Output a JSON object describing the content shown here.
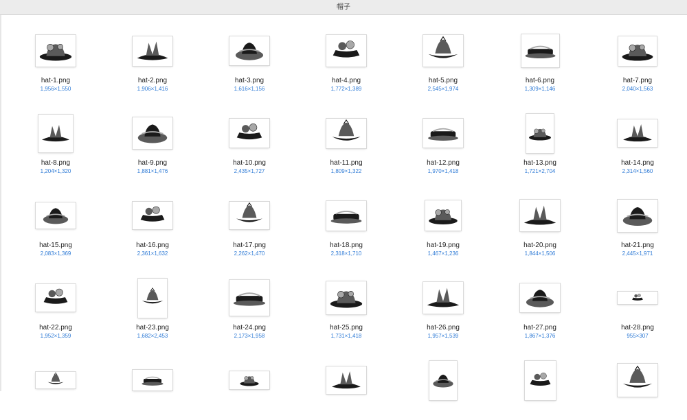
{
  "window": {
    "title": "帽子"
  },
  "items": [
    {
      "name": "hat-1.png",
      "dims": "1,956×1,550",
      "icon": "hat-image-icon"
    },
    {
      "name": "hat-2.png",
      "dims": "1,906×1,416",
      "icon": "hat-image-icon"
    },
    {
      "name": "hat-3.png",
      "dims": "1,616×1,156",
      "icon": "hat-image-icon"
    },
    {
      "name": "hat-4.png",
      "dims": "1,772×1,389",
      "icon": "hat-image-icon"
    },
    {
      "name": "hat-5.png",
      "dims": "2,545×1,974",
      "icon": "hat-image-icon"
    },
    {
      "name": "hat-6.png",
      "dims": "1,309×1,146",
      "icon": "hat-image-icon"
    },
    {
      "name": "hat-7.png",
      "dims": "2,040×1,563",
      "icon": "hat-image-icon"
    },
    {
      "name": "hat-8.png",
      "dims": "1,204×1,320",
      "icon": "hat-image-icon"
    },
    {
      "name": "hat-9.png",
      "dims": "1,881×1,476",
      "icon": "hat-image-icon"
    },
    {
      "name": "hat-10.png",
      "dims": "2,435×1,727",
      "icon": "hat-image-icon"
    },
    {
      "name": "hat-11.png",
      "dims": "1,809×1,322",
      "icon": "hat-image-icon"
    },
    {
      "name": "hat-12.png",
      "dims": "1,970×1,418",
      "icon": "hat-image-icon"
    },
    {
      "name": "hat-13.png",
      "dims": "1,721×2,704",
      "icon": "hat-image-icon"
    },
    {
      "name": "hat-14.png",
      "dims": "2,314×1,560",
      "icon": "hat-image-icon"
    },
    {
      "name": "hat-15.png",
      "dims": "2,083×1,369",
      "icon": "hat-image-icon"
    },
    {
      "name": "hat-16.png",
      "dims": "2,361×1,632",
      "icon": "hat-image-icon"
    },
    {
      "name": "hat-17.png",
      "dims": "2,262×1,470",
      "icon": "hat-image-icon"
    },
    {
      "name": "hat-18.png",
      "dims": "2,318×1,710",
      "icon": "hat-image-icon"
    },
    {
      "name": "hat-19.png",
      "dims": "1,467×1,236",
      "icon": "hat-image-icon"
    },
    {
      "name": "hat-20.png",
      "dims": "1,844×1,506",
      "icon": "hat-image-icon"
    },
    {
      "name": "hat-21.png",
      "dims": "2,445×1,971",
      "icon": "hat-image-icon"
    },
    {
      "name": "hat-22.png",
      "dims": "1,952×1,359",
      "icon": "hat-image-icon"
    },
    {
      "name": "hat-23.png",
      "dims": "1,682×2,453",
      "icon": "hat-image-icon"
    },
    {
      "name": "hat-24.png",
      "dims": "2,173×1,958",
      "icon": "hat-image-icon"
    },
    {
      "name": "hat-25.png",
      "dims": "1,731×1,418",
      "icon": "hat-image-icon"
    },
    {
      "name": "hat-26.png",
      "dims": "1,957×1,539",
      "icon": "hat-image-icon"
    },
    {
      "name": "hat-27.png",
      "dims": "1,867×1,376",
      "icon": "hat-image-icon"
    },
    {
      "name": "hat-28.png",
      "dims": "955×307",
      "icon": "hat-image-icon"
    },
    {
      "name": "",
      "dims": "",
      "icon": "hat-image-icon"
    },
    {
      "name": "",
      "dims": "",
      "icon": "hat-image-icon"
    },
    {
      "name": "",
      "dims": "",
      "icon": "hat-image-icon"
    },
    {
      "name": "",
      "dims": "",
      "icon": "hat-image-icon"
    },
    {
      "name": "",
      "dims": "",
      "icon": "hat-image-icon"
    },
    {
      "name": "",
      "dims": "",
      "icon": "hat-image-icon"
    },
    {
      "name": "",
      "dims": "",
      "icon": "hat-image-icon"
    }
  ],
  "colors": {
    "titlebar": "#ececec",
    "filename": "#1f1f1f",
    "dimensions": "#2f7bd6"
  }
}
